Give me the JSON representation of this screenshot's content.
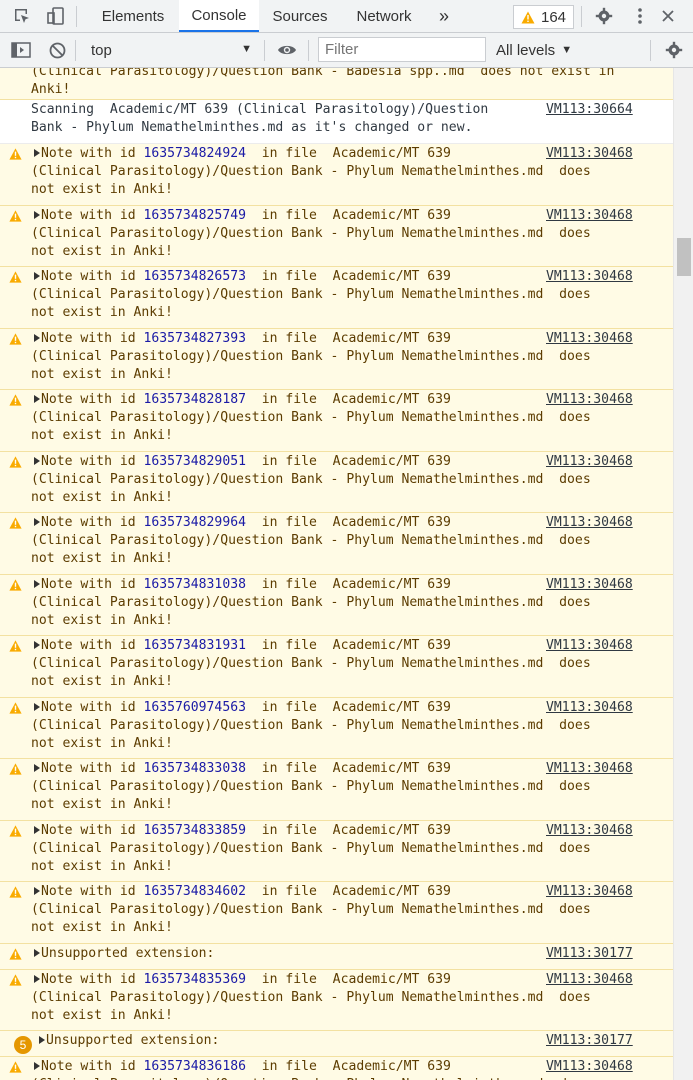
{
  "tabs": [
    {
      "label": "Elements"
    },
    {
      "label": "Console"
    },
    {
      "label": "Sources"
    },
    {
      "label": "Network"
    }
  ],
  "warning_count": "164",
  "toolbar": {
    "context": "top",
    "filter_placeholder": "Filter",
    "levels_label": "All levels"
  },
  "colors": {
    "warning_bg": "#fffbe5",
    "warning_text": "#5c3c00",
    "id_blue": "#1a1aa6",
    "accent": "#1a73e8",
    "badge": "#e59700"
  },
  "messages": [
    {
      "type": "warning-cont",
      "lines": [
        "(Clinical Parasitology)/Question Bank - Babesia spp..md  does not exist in",
        "Anki!"
      ]
    },
    {
      "type": "info",
      "lines": [
        "Scanning  Academic/MT 639 (Clinical Parasitology)/Question",
        "Bank - Phylum Nemathelminthes.md as it's changed or new."
      ],
      "source": "VM113:30664"
    },
    {
      "type": "note",
      "id": "1635734824924",
      "source": "VM113:30468"
    },
    {
      "type": "note",
      "id": "1635734825749",
      "source": "VM113:30468"
    },
    {
      "type": "note",
      "id": "1635734826573",
      "source": "VM113:30468"
    },
    {
      "type": "note",
      "id": "1635734827393",
      "source": "VM113:30468"
    },
    {
      "type": "note",
      "id": "1635734828187",
      "source": "VM113:30468"
    },
    {
      "type": "note",
      "id": "1635734829051",
      "source": "VM113:30468"
    },
    {
      "type": "note",
      "id": "1635734829964",
      "source": "VM113:30468"
    },
    {
      "type": "note",
      "id": "1635734831038",
      "source": "VM113:30468"
    },
    {
      "type": "note",
      "id": "1635734831931",
      "source": "VM113:30468"
    },
    {
      "type": "note",
      "id": "1635760974563",
      "source": "VM113:30468"
    },
    {
      "type": "note",
      "id": "1635734833038",
      "source": "VM113:30468"
    },
    {
      "type": "note",
      "id": "1635734833859",
      "source": "VM113:30468"
    },
    {
      "type": "note",
      "id": "1635734834602",
      "source": "VM113:30468"
    },
    {
      "type": "ext",
      "text": "Unsupported extension:",
      "source": "VM113:30177"
    },
    {
      "type": "note",
      "id": "1635734835369",
      "source": "VM113:30468"
    },
    {
      "type": "ext",
      "text": "Unsupported extension:",
      "source": "VM113:30177",
      "repeat": "5"
    },
    {
      "type": "note",
      "id": "1635734836186",
      "source": "VM113:30468"
    }
  ],
  "note_text": {
    "prefix": "Note with id ",
    "in_file": "  in file  Academic/MT 639",
    "line2": "(Clinical Parasitology)/Question Bank - Phylum Nemathelminthes.md  does",
    "line3": "not exist in Anki!"
  }
}
